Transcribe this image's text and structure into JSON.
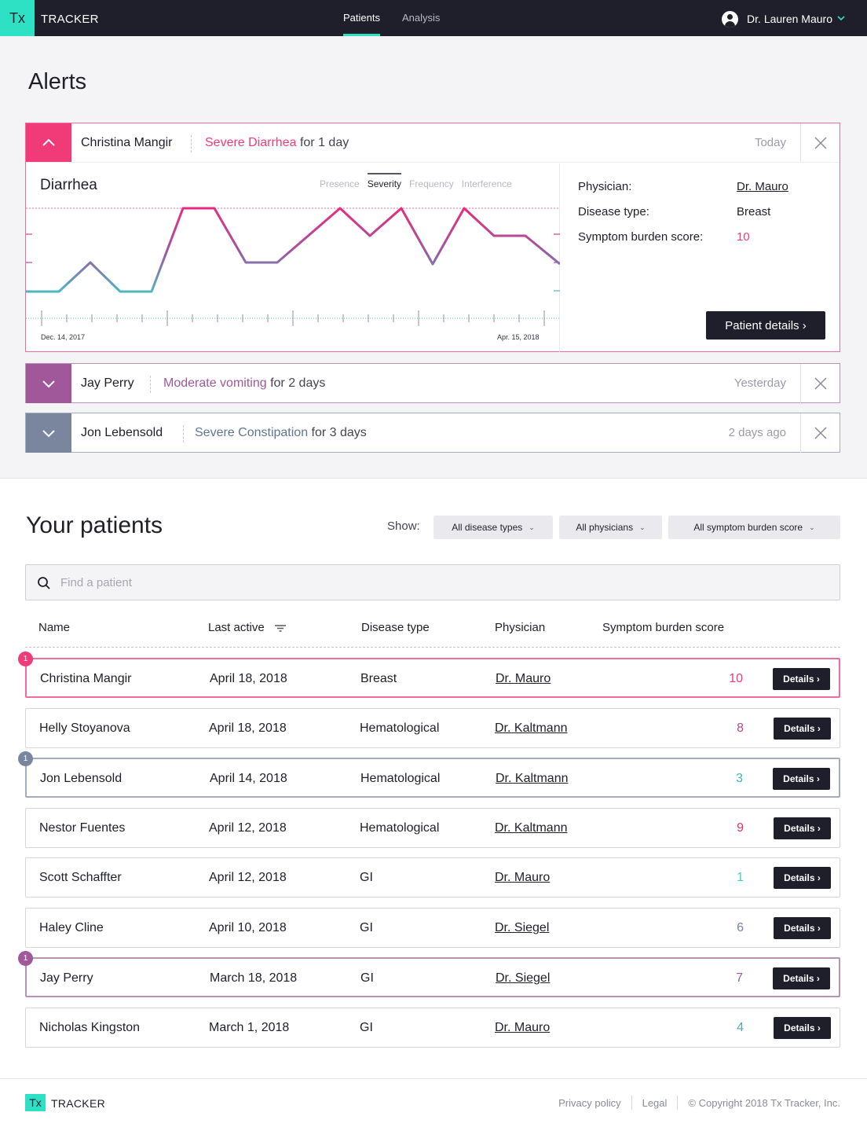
{
  "app": {
    "logo_mark": "Tx",
    "logo_text": "TRACKER"
  },
  "nav": {
    "tabs": [
      {
        "label": "Patients",
        "active": true
      },
      {
        "label": "Analysis",
        "active": false
      }
    ],
    "user_name": "Dr. Lauren Mauro"
  },
  "alerts": {
    "title": "Alerts",
    "items": [
      {
        "patient": "Christina Mangir",
        "condition": "Severe Diarrhea",
        "duration": "for 1 day",
        "time": "Today",
        "expanded": true,
        "color": "#f13b79",
        "chart": {
          "title": "Diarrhea",
          "tabs": [
            "Presence",
            "Severity",
            "Frequency",
            "Interference"
          ],
          "active_tab": "Severity",
          "date_start": "Dec. 14, 2017",
          "date_end": "Apr. 15, 2018"
        },
        "info": {
          "physician_label": "Physician:",
          "physician": "Dr. Mauro",
          "disease_label": "Disease type:",
          "disease": "Breast",
          "score_label": "Symptom burden score:",
          "score": "10"
        },
        "button": "Patient details ›"
      },
      {
        "patient": "Jay Perry",
        "condition": "Moderate vomiting",
        "duration": "for 2 days",
        "time": "Yesterday",
        "expanded": false,
        "color": "#a0589b"
      },
      {
        "patient": "Jon Lebensold",
        "condition": "Severe Constipation",
        "duration": "for 3 days",
        "time": "2 days ago",
        "expanded": false,
        "color": "#7a859e"
      }
    ]
  },
  "patients": {
    "title": "Your patients",
    "show_label": "Show:",
    "filters": [
      "All disease types",
      "All physicians",
      "All symptom burden score"
    ],
    "search_placeholder": "Find a patient",
    "columns": [
      "Name",
      "Last active",
      "Disease type",
      "Physician",
      "Symptom burden score"
    ],
    "details_label": "Details ›",
    "rows": [
      {
        "name": "Christina Mangir",
        "last_active": "April 18, 2018",
        "disease": "Breast",
        "physician": "Dr. Mauro",
        "score": "10",
        "score_color": "#f13b79",
        "alert_count": "1",
        "alert_color": "#f13b79"
      },
      {
        "name": "Helly Stoyanova",
        "last_active": "April 18, 2018",
        "disease": "Hematological",
        "physician": "Dr. Kaltmann",
        "score": "8",
        "score_color": "#b04a8f"
      },
      {
        "name": "Jon Lebensold",
        "last_active": "April 14, 2018",
        "disease": "Hematological",
        "physician": "Dr. Kaltmann",
        "score": "3",
        "score_color": "#3bb8b3",
        "alert_count": "1",
        "alert_color": "#7a859e"
      },
      {
        "name": "Nestor Fuentes",
        "last_active": "April 12, 2018",
        "disease": "Hematological",
        "physician": "Dr. Kaltmann",
        "score": "9",
        "score_color": "#e3306f"
      },
      {
        "name": "Scott Schaffter",
        "last_active": "April 12, 2018",
        "disease": "GI",
        "physician": "Dr. Mauro",
        "score": "1",
        "score_color": "#39d6b5"
      },
      {
        "name": "Haley Cline",
        "last_active": "April 10, 2018",
        "disease": "GI",
        "physician": "Dr. Siegel",
        "score": "6",
        "score_color": "#7482a8"
      },
      {
        "name": "Jay Perry",
        "last_active": "March 18, 2018",
        "disease": "GI",
        "physician": "Dr. Siegel",
        "score": "7",
        "score_color": "#9a5ea0",
        "alert_count": "1",
        "alert_color": "#a0589b"
      },
      {
        "name": "Nicholas Kingston",
        "last_active": "March 1, 2018",
        "disease": "GI",
        "physician": "Dr. Mauro",
        "score": "4",
        "score_color": "#52a8b8"
      }
    ]
  },
  "footer": {
    "logo_mark": "Tx",
    "logo_text": "TRACKER",
    "links": [
      "Privacy policy",
      "Legal"
    ],
    "copyright": "© Copyright 2018 Tx Tracker, Inc."
  },
  "colors": {
    "accent": "#2ee0c4",
    "navbar": "#1f1e2b",
    "alert_pink": "#f13b79",
    "alert_purple": "#a0589b",
    "alert_slate": "#7a859e"
  },
  "icons": {
    "collapse": "chevron-up-icon",
    "expand": "chevron-down-icon",
    "close": "close-icon",
    "search": "search-icon",
    "sort": "sort-icon",
    "user": "user-avatar-icon"
  }
}
